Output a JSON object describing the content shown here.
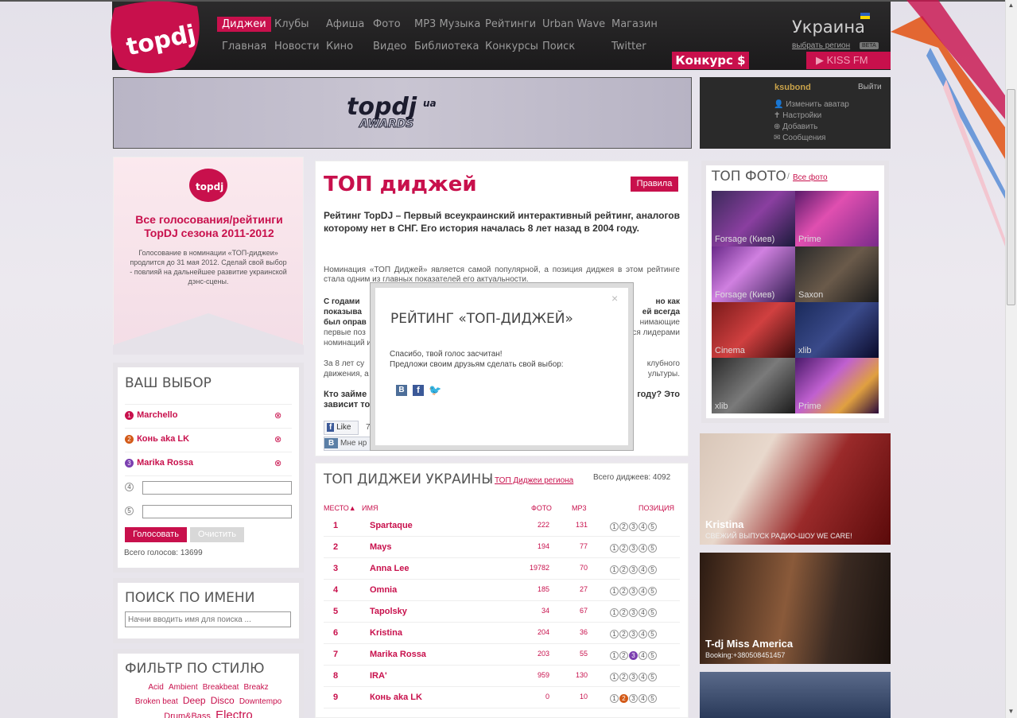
{
  "header": {
    "nav_row1": [
      "Диджеи",
      "Клубы",
      "Афиша",
      "Фото",
      "MP3 Музыка",
      "Рейтинги",
      "Urban Wave",
      "Магазин"
    ],
    "nav_row2": [
      "Главная",
      "Новости",
      "Кино",
      "Видео",
      "Библиотека",
      "Конкурсы",
      "Поиск",
      "Twitter"
    ],
    "region": "Украина",
    "region_link": "выбрать регион",
    "beta": "BETA",
    "konkurs": "Конкурс $",
    "kissfm": "KISS FM"
  },
  "user": {
    "name": "ksubond",
    "logout": "Выйти",
    "menu": [
      "Изменить аватар",
      "Настройки",
      "Добавить",
      "Сообщения"
    ]
  },
  "voting_box": {
    "title": "Все голосования/рейтинги TopDJ сезона 2011-2012",
    "text": "Голосование в номинации «ТОП-диджеи» продлится до 31 мая 2012. Сделай свой выбор - повлияй на дальнейшее развитие украинской дэнс-сцены."
  },
  "your_choice": {
    "title": "ВАШ ВЫБОР",
    "choices": [
      "Marchello",
      "Конь aka LK",
      "Marika Rossa"
    ],
    "empty_slots": [
      "4",
      "5"
    ],
    "vote_button": "Голосовать",
    "clear_button": "Очистить",
    "total_votes": "Всего голосов: 13699"
  },
  "search_by_name": {
    "title": "ПОИСК ПО ИМЕНИ",
    "placeholder": "Начни вводить имя для поиска ..."
  },
  "style_filter": {
    "title": "ФИЛЬТР ПО СТИЛЮ",
    "styles": [
      "Acid",
      "Ambient",
      "Breakbeat",
      "Breakz",
      "Broken beat",
      "Deep",
      "Disco",
      "Downtempo",
      "Drum&Bass",
      "Electro"
    ]
  },
  "main": {
    "title": "ТОП диджей",
    "rules_button": "Правила",
    "intro": "Рейтинг TopDJ – Первый всеукраинский интерактивный рейтинг, аналогов которому нет в СНГ. Его история началась 8 лет назад в 2004 году.",
    "p1_visible": "Номинация «ТОП Диджей» является самой популярной, а позиция диджея в этом рейтинге стала одним из главных показателей его актуальности.",
    "p2_left": "С годами",
    "p2_right": "но как",
    "p2_left2": "показыва",
    "p2_right2": "ей всегда",
    "p2_left3": "был оправ",
    "p2_right3": "нимающие",
    "p2_left4": "первые поз",
    "p2_right4": "ся лидерами",
    "p2_left5": "номинаций и",
    "p3_left": "За 8 лет су",
    "p3_right": "клубного",
    "p3_left2": "движения, а",
    "p3_right2": "ультуры.",
    "p4_left": "Кто займе",
    "p4_right": "году? Это",
    "p4_left2": "зависит то",
    "like": "Like",
    "like_count": "7",
    "vk_share": "Мне нр"
  },
  "top_list": {
    "title": "ТОП ДИДЖЕИ УКРАИНЫ",
    "region_link": "ТОП Диджеи региона",
    "total": "Всего диджеев: 4092",
    "col_place": "МЕСТО",
    "col_name": "ИМЯ",
    "col_photo": "ФОТО",
    "col_mp3": "MP3",
    "col_position": "ПОЗИЦИЯ",
    "rows": [
      {
        "place": "1",
        "name": "Spartaque",
        "photo": "222",
        "mp3": "131"
      },
      {
        "place": "2",
        "name": "Mays",
        "photo": "194",
        "mp3": "77"
      },
      {
        "place": "3",
        "name": "Anna Lee",
        "photo": "19782",
        "mp3": "70"
      },
      {
        "place": "4",
        "name": "Omnia",
        "photo": "185",
        "mp3": "27"
      },
      {
        "place": "5",
        "name": "Tapolsky",
        "photo": "34",
        "mp3": "67"
      },
      {
        "place": "6",
        "name": "Kristina",
        "photo": "204",
        "mp3": "36"
      },
      {
        "place": "7",
        "name": "Marika Rossa",
        "photo": "203",
        "mp3": "55"
      },
      {
        "place": "8",
        "name": "IRA'",
        "photo": "959",
        "mp3": "130"
      },
      {
        "place": "9",
        "name": "Конь aka LK",
        "photo": "0",
        "mp3": "10"
      }
    ]
  },
  "top_photo": {
    "title": "ТОП ФОТО",
    "all_link": "Все фото",
    "items": [
      "Forsage (Киев)",
      "Prime",
      "Forsage (Киев)",
      "Saxon",
      "Cinema",
      "xlib",
      "xlib",
      "Prime"
    ]
  },
  "promo": [
    {
      "title": "Kristina",
      "subtitle": "СВЕЖИЙ ВЫПУСК РАДИО-ШОУ WE CARE!"
    },
    {
      "title": "T-dj Miss America",
      "subtitle": "Booking:+380508451457"
    }
  ],
  "modal": {
    "title": "РЕЙТИНГ «ТОП-ДИДЖЕЙ»",
    "line1": "Спасибо, твой голос засчитан!",
    "line2": "Предложи своим друзьям сделать свой выбор:",
    "close": "×"
  },
  "colors": {
    "accent": "#c8104c",
    "header_bg": "#222222"
  }
}
